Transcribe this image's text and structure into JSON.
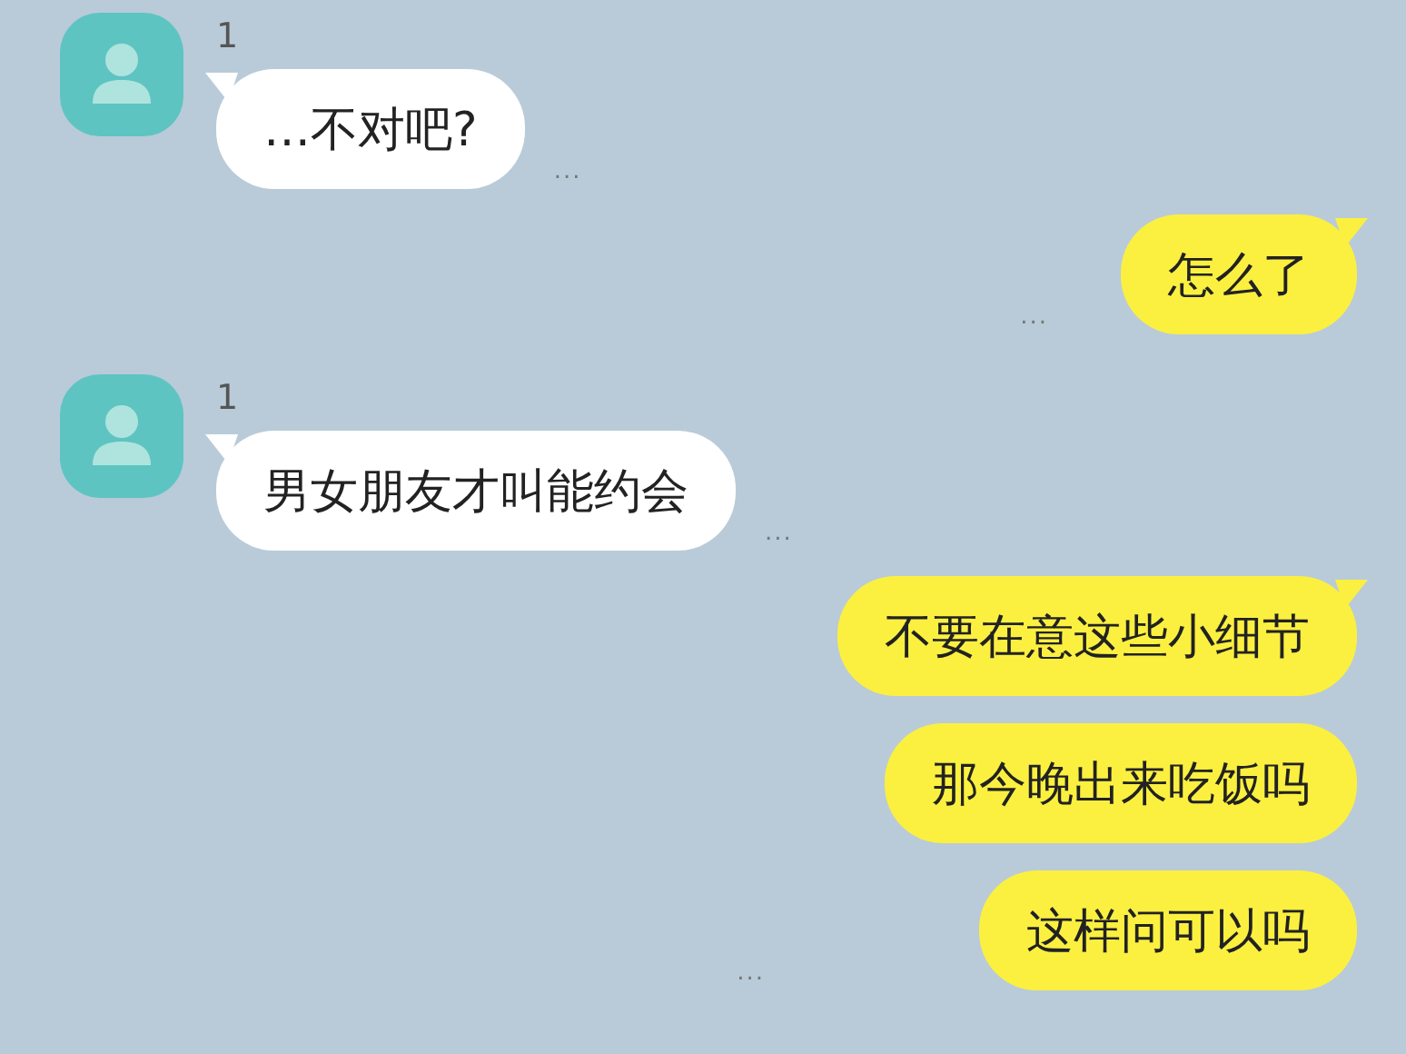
{
  "messages": [
    {
      "kind": "received",
      "sender": "1",
      "bubbles": [
        "…不对吧?"
      ],
      "meta": "..."
    },
    {
      "kind": "sent",
      "bubbles": [
        "怎么了"
      ],
      "meta": "..."
    },
    {
      "kind": "received",
      "sender": "1",
      "bubbles": [
        "男女朋友才叫能约会"
      ],
      "meta": "..."
    },
    {
      "kind": "sent",
      "bubbles": [
        "不要在意这些小细节",
        "那今晚出来吃饭吗",
        "这样问可以吗"
      ],
      "meta": "..."
    }
  ]
}
